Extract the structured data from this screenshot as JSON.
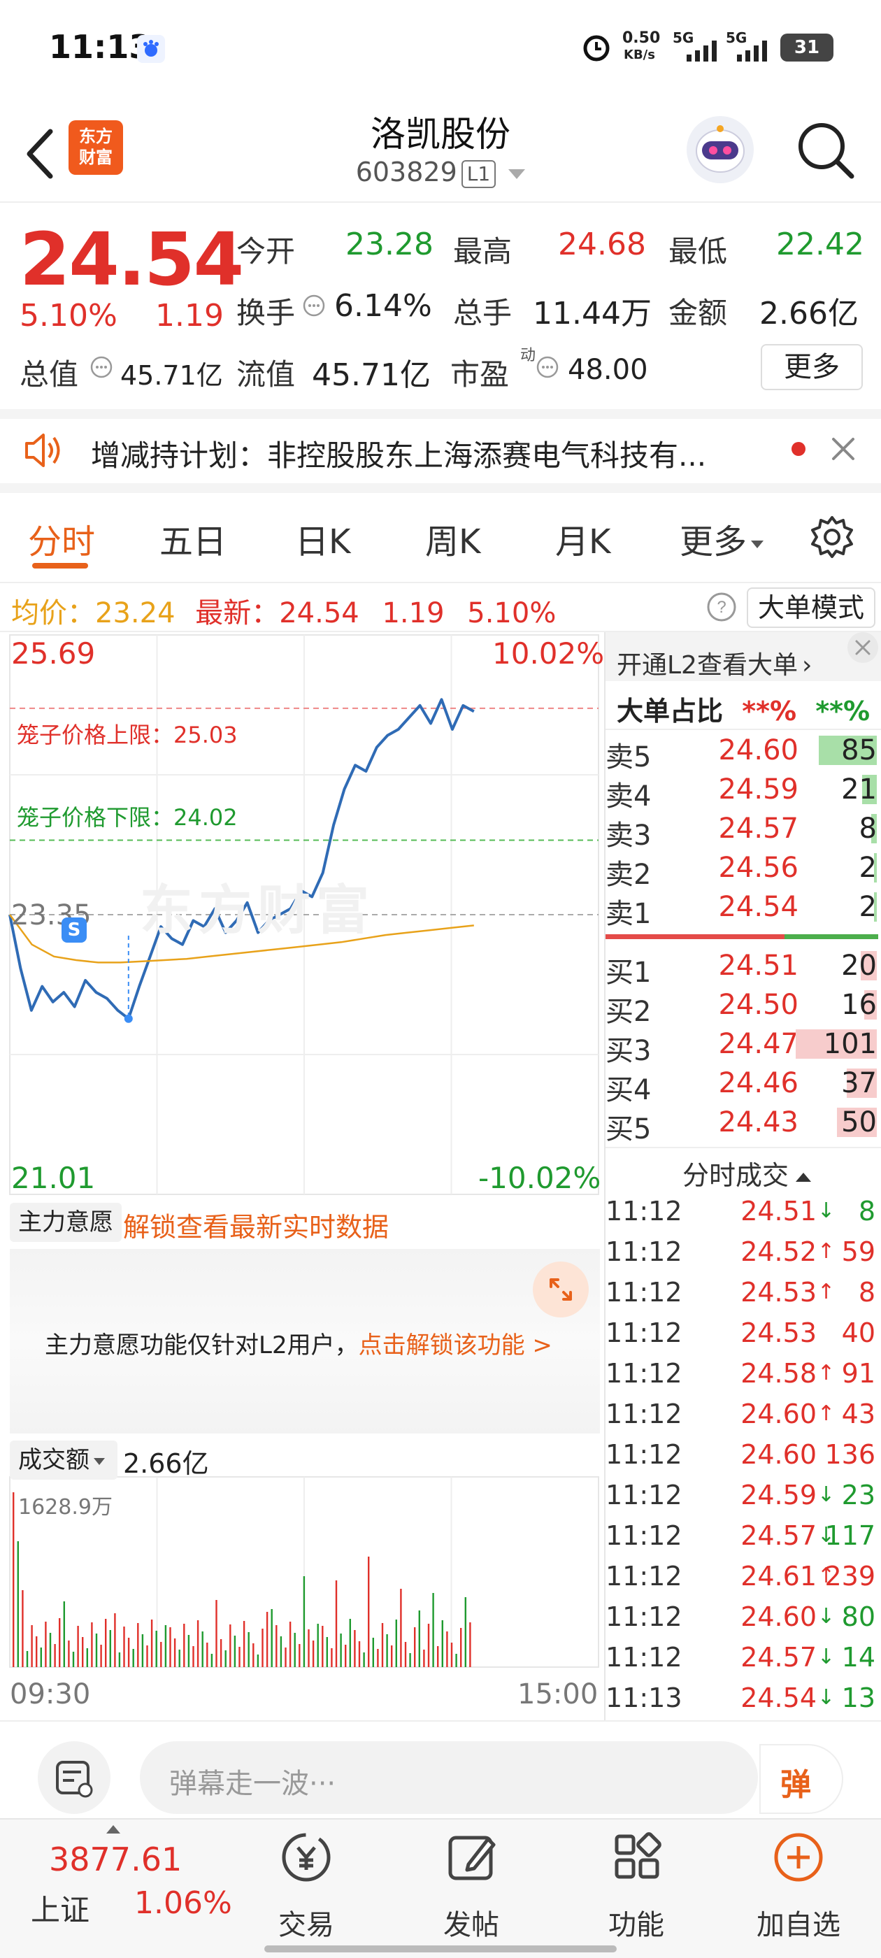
{
  "status_bar": {
    "time": "11:13",
    "net_speed": "0.50",
    "net_unit": "KB/s",
    "sig1": "5G",
    "sig2": "5G",
    "battery": "31"
  },
  "header": {
    "logo_line1": "东方",
    "logo_line2": "财富",
    "stock_name": "洛凯股份",
    "stock_code": "603829",
    "level_tag": "L1"
  },
  "quote": {
    "price": "24.54",
    "change_pct": "5.10%",
    "change": "1.19",
    "open_label": "今开",
    "open": "23.28",
    "high_label": "最高",
    "high": "24.68",
    "low_label": "最低",
    "low": "22.42",
    "turnover_label": "换手",
    "turnover": "6.14%",
    "volume_label": "总手",
    "volume": "11.44万",
    "amount_label": "金额",
    "amount": "2.66亿",
    "total_cap_label": "总值",
    "total_cap": "45.71亿",
    "float_cap_label": "流值",
    "float_cap": "45.71亿",
    "pe_label": "市盈",
    "pe_sup": "动",
    "pe": "48.00",
    "more_label": "更多"
  },
  "notice": {
    "text": "增减持计划：非控股股东上海添赛电气科技有..."
  },
  "tabs": [
    {
      "label": "分时",
      "active": true
    },
    {
      "label": "五日"
    },
    {
      "label": "日K"
    },
    {
      "label": "周K"
    },
    {
      "label": "月K"
    },
    {
      "label": "更多"
    }
  ],
  "info_bar": {
    "avg_label": "均价：",
    "avg": "23.24",
    "latest_label": "最新：",
    "latest": "24.54",
    "change": "1.19",
    "change_pct": "5.10%",
    "mode_label": "大单模式"
  },
  "chart": {
    "top_price": "25.69",
    "top_pct": "10.02%",
    "bottom_price": "21.01",
    "bottom_pct": "-10.02%",
    "prev_close": "23.35",
    "cage_upper_label": "笼子价格上限：",
    "cage_upper": "25.03",
    "cage_lower_label": "笼子价格下限：",
    "cage_lower": "24.02",
    "watermark": "东方财富",
    "s_marker": "S",
    "intent_label": "主力意愿",
    "intent_unlock": "解锁查看最新实时数据",
    "intent_notice": "主力意愿功能仅针对L2用户，",
    "intent_link": "点击解锁该功能 >",
    "volume_label": "成交额",
    "volume_total": "2.66亿",
    "volume_max": "1628.9万",
    "time_start": "09:30",
    "time_end": "15:00"
  },
  "chart_data": {
    "type": "line",
    "title": "",
    "y_range": [
      21.01,
      25.69
    ],
    "prev_close": 23.35,
    "x_range": [
      "09:30",
      "15:00"
    ],
    "series": [
      {
        "values": [
          23.35,
          22.9,
          22.55,
          22.75,
          22.62,
          22.7,
          22.58,
          22.8,
          22.7,
          22.65,
          22.55,
          22.48,
          22.75,
          23.0,
          23.25,
          23.15,
          23.1,
          23.3,
          23.25,
          23.4,
          23.2,
          23.3,
          23.45,
          23.2,
          23.3,
          23.35,
          23.4,
          23.55,
          23.5,
          23.7,
          24.1,
          24.4,
          24.6,
          24.55,
          24.75,
          24.85,
          24.9,
          25.0,
          25.1,
          24.95,
          25.15,
          24.9,
          25.1,
          25.05
        ]
      },
      {
        "values": [
          23.35,
          23.1,
          23.0,
          22.97,
          22.95,
          22.95,
          22.96,
          22.97,
          22.98,
          23.0,
          23.02,
          23.04,
          23.06,
          23.08,
          23.1,
          23.12,
          23.15,
          23.18,
          23.2,
          23.22,
          23.24,
          23.26
        ]
      }
    ]
  },
  "order_book": {
    "l2_link": "开通L2查看大单",
    "big_order_label": "大单占比",
    "big_order_sell": "**%",
    "big_order_buy": "**%",
    "sells": [
      {
        "label": "卖5",
        "price": "24.60",
        "vol": "85"
      },
      {
        "label": "卖4",
        "price": "24.59",
        "vol": "21"
      },
      {
        "label": "卖3",
        "price": "24.57",
        "vol": "8"
      },
      {
        "label": "卖2",
        "price": "24.56",
        "vol": "2"
      },
      {
        "label": "卖1",
        "price": "24.54",
        "vol": "2"
      }
    ],
    "buys": [
      {
        "label": "买1",
        "price": "24.51",
        "vol": "20"
      },
      {
        "label": "买2",
        "price": "24.50",
        "vol": "16"
      },
      {
        "label": "买3",
        "price": "24.47",
        "vol": "101"
      },
      {
        "label": "买4",
        "price": "24.46",
        "vol": "37"
      },
      {
        "label": "买5",
        "price": "24.43",
        "vol": "50"
      }
    ],
    "trades_header": "分时成交",
    "trades": [
      {
        "time": "11:12",
        "price": "24.51",
        "dir": "↓",
        "vol": "8"
      },
      {
        "time": "11:12",
        "price": "24.52",
        "dir": "↑",
        "vol": "59"
      },
      {
        "time": "11:12",
        "price": "24.53",
        "dir": "↑",
        "vol": "8"
      },
      {
        "time": "11:12",
        "price": "24.53",
        "dir": "",
        "vol": "40"
      },
      {
        "time": "11:12",
        "price": "24.58",
        "dir": "↑",
        "vol": "91"
      },
      {
        "time": "11:12",
        "price": "24.60",
        "dir": "↑",
        "vol": "43"
      },
      {
        "time": "11:12",
        "price": "24.60",
        "dir": "",
        "vol": "136"
      },
      {
        "time": "11:12",
        "price": "24.59",
        "dir": "↓",
        "vol": "23"
      },
      {
        "time": "11:12",
        "price": "24.57",
        "dir": "↓",
        "vol": "117"
      },
      {
        "time": "11:12",
        "price": "24.61",
        "dir": "↑",
        "vol": "239"
      },
      {
        "time": "11:12",
        "price": "24.60",
        "dir": "↓",
        "vol": "80"
      },
      {
        "time": "11:12",
        "price": "24.57",
        "dir": "↓",
        "vol": "14"
      },
      {
        "time": "11:13",
        "price": "24.54",
        "dir": "↓",
        "vol": "13"
      }
    ]
  },
  "comment": {
    "placeholder": "弹幕走一波···",
    "danmu_label": "弹"
  },
  "bottom_nav": {
    "index_value": "3877.61",
    "index_name": "上证",
    "index_change": "1.06%",
    "trade": "交易",
    "post": "发帖",
    "func": "功能",
    "add": "加自选"
  }
}
